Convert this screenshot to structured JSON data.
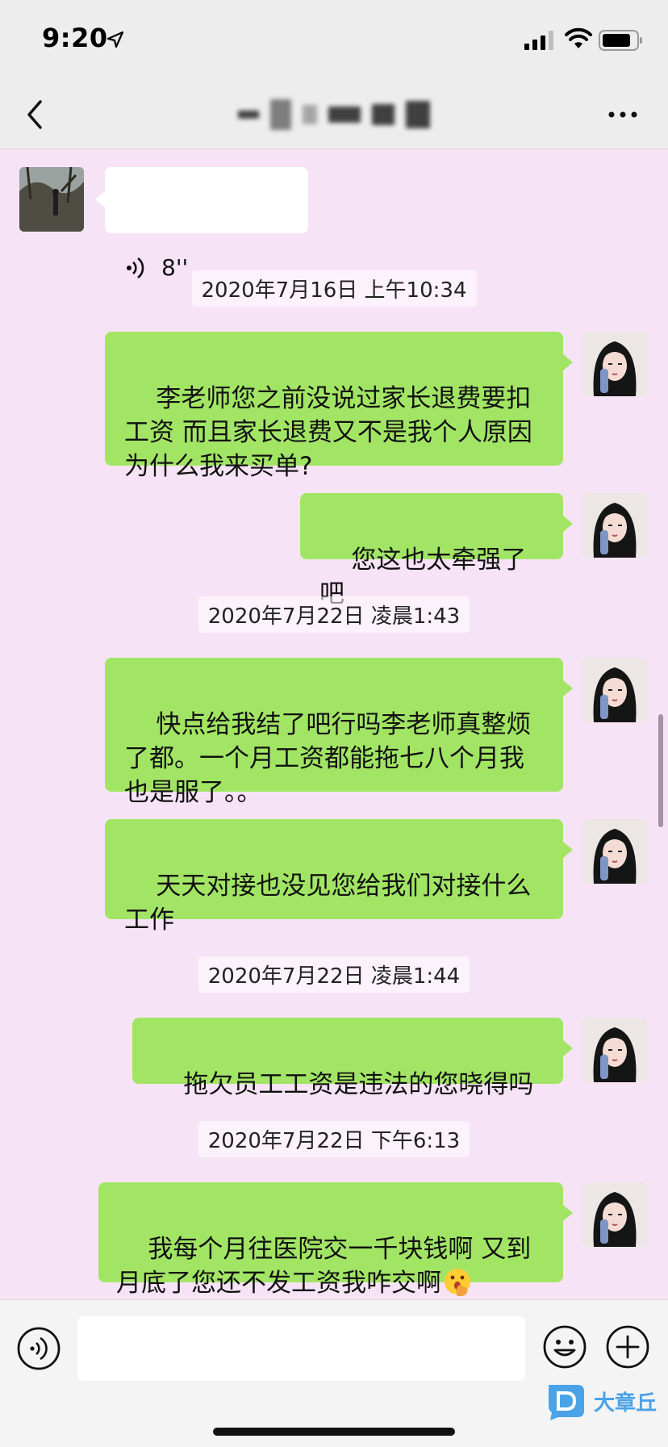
{
  "status_bar": {
    "time": "9:20",
    "icons": [
      "location-arrow-icon",
      "cellular-signal-icon",
      "wifi-icon",
      "battery-icon"
    ]
  },
  "nav": {
    "title": "",
    "back_icon": "chevron-left-icon",
    "more_icon": "ellipsis-icon"
  },
  "chat": {
    "incoming_voice": {
      "duration": "8''",
      "icon": "voice-wave-icon"
    },
    "timestamps": [
      "2020年7月16日 上午10:34",
      "2020年7月22日 凌晨1:43",
      "2020年7月22日 凌晨1:44",
      "2020年7月22日 下午6:13"
    ],
    "messages": [
      "李老师您之前没说过家长退费要扣工资 而且家长退费又不是我个人原因为什么我来买单?",
      "您这也太牵强了吧",
      "快点给我结了吧行吗李老师真整烦了都。一个月工资都能拖七八个月我也是服了。。",
      "天天对接也没见您给我们对接什么工作",
      "拖欠员工工资是违法的您晓得吗",
      "我每个月往医院交一千块钱啊 又到月底了您还不发工资我咋交啊"
    ],
    "emoji": "face-with-hand-over-mouth-emoji"
  },
  "input_bar": {
    "placeholder": "",
    "icons": [
      "voice-input-icon",
      "emoji-face-icon",
      "plus-circle-icon"
    ]
  },
  "watermark": {
    "text": "大章丘"
  },
  "colors": {
    "chat_background": "#f7e3f6",
    "outgoing_bubble": "#a2e565",
    "incoming_bubble": "#ffffff",
    "bar_background": "#ededed",
    "watermark": "#4aa3e8"
  }
}
